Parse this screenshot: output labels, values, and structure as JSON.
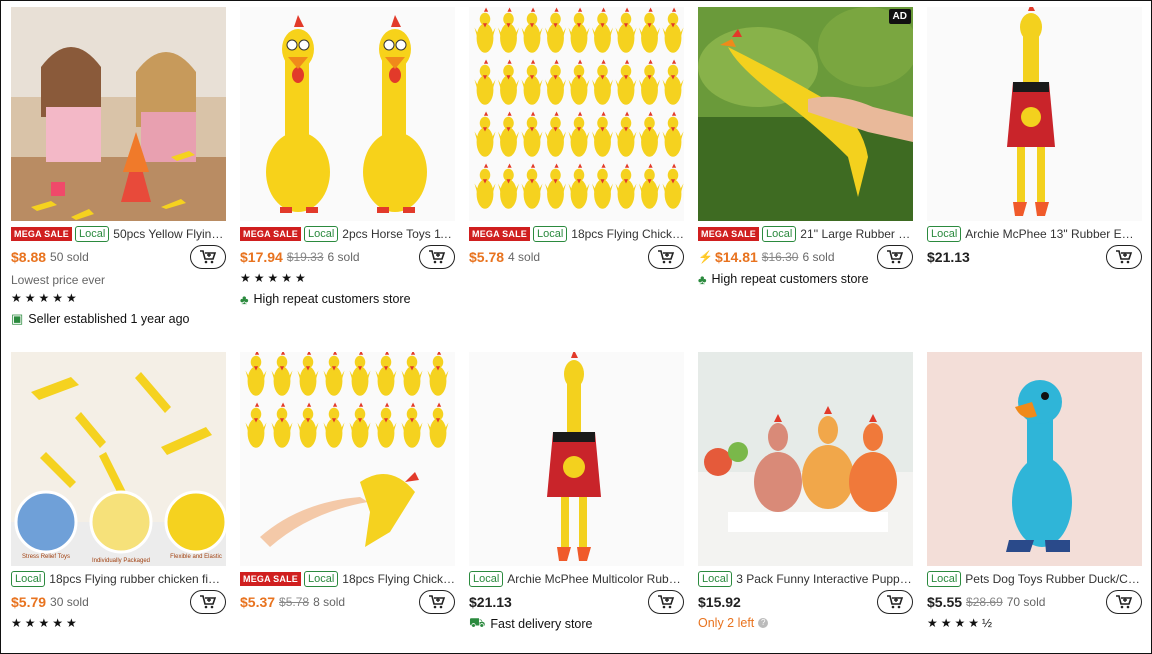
{
  "products": [
    {
      "title": "50pcs Yellow Flying C...",
      "mega": "MEGA SALE",
      "local": "Local",
      "price": "$8.88",
      "old": "",
      "sold": "50 sold",
      "note": "Lowest price ever",
      "stars": "★★★★★",
      "badge": "Seller established 1 year ago",
      "badge_icon": "seller-icon"
    },
    {
      "title": "2pcs Horse Toys 11 Inc...",
      "mega": "MEGA SALE",
      "local": "Local",
      "price": "$17.94",
      "old": "$19.33",
      "sold": "6 sold",
      "stars": "★★★★★",
      "badge": "High repeat customers store",
      "badge_icon": "repeat-customers-icon"
    },
    {
      "title": "18pcs Flying Chicken ...",
      "mega": "MEGA SALE",
      "local": "Local",
      "price": "$5.78",
      "old": "",
      "sold": "4 sold"
    },
    {
      "title": "21'' Large Rubber Chic...",
      "mega": "MEGA SALE",
      "local": "Local",
      "price": "$14.81",
      "old": "$16.30",
      "sold": "6 sold",
      "ad": "AD",
      "badge": "High repeat customers store",
      "badge_icon": "repeat-customers-icon",
      "bolt": true
    },
    {
      "title": "Archie McPhee 13\" Rubber Emoti...",
      "local": "Local",
      "price": "$21.13",
      "price_black": true
    },
    {
      "title": "18pcs Flying rubber chicken fing...",
      "local": "Local",
      "price": "$5.79",
      "sold": "30 sold",
      "stars": "★★★★★"
    },
    {
      "title": "18pcs Flying Chicken ...",
      "mega": "MEGA SALE",
      "local": "Local",
      "price": "$5.37",
      "old": "$5.78",
      "sold": "8 sold"
    },
    {
      "title": "Archie McPhee Multicolor Rubbe...",
      "local": "Local",
      "price": "$21.13",
      "price_black": true,
      "badge": "Fast delivery store",
      "badge_icon": "truck-icon"
    },
    {
      "title": "3 Pack Funny Interactive Puppy ...",
      "local": "Local",
      "price": "$15.92",
      "price_black": true,
      "stock": "Only 2 left"
    },
    {
      "title": "Pets Dog Toys Rubber Duck/Chic...",
      "local": "Local",
      "price": "$5.55",
      "price_black": true,
      "old": "$28.69",
      "sold": "70 sold",
      "stars": "★★★★½"
    }
  ],
  "image_labels": {
    "stress": "Stress Relief Toys",
    "packaged": "Individually Packaged",
    "flex": "Flexible and Elastic"
  },
  "colors": {
    "accent": "#e8731f",
    "sale": "#d01f1f",
    "local": "#2b8a3e"
  }
}
